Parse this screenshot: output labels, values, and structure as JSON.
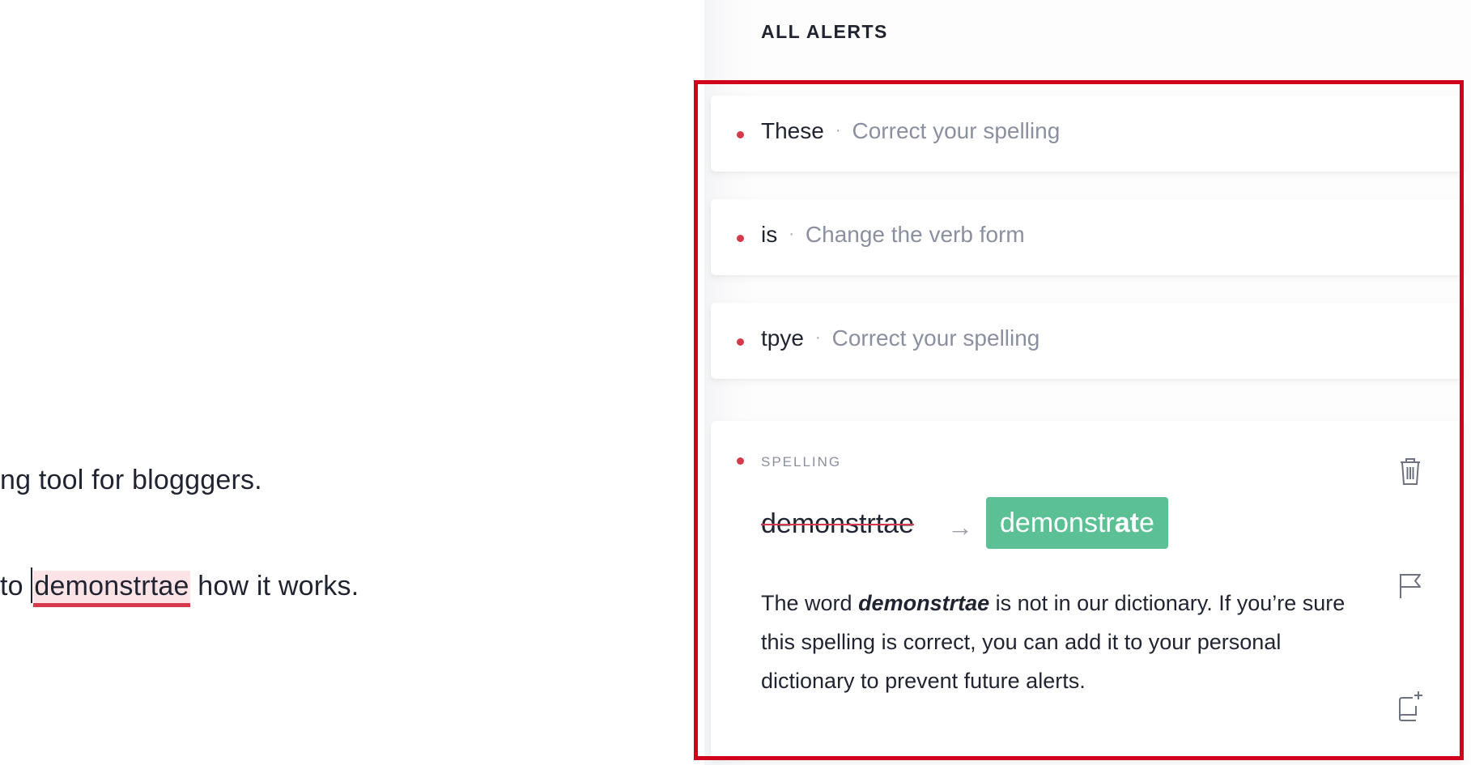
{
  "editor": {
    "line1": "ng tool for blogggers.",
    "line2_before": "to ",
    "line2_flagged": "demonstrtae",
    "line2_after": " how it works."
  },
  "sidebar": {
    "heading": "ALL ALERTS",
    "alerts": [
      {
        "word": "These",
        "separator": "·",
        "description": "Correct your spelling"
      },
      {
        "word": "is",
        "separator": "·",
        "description": "Change the verb form"
      },
      {
        "word": "tpye",
        "separator": "·",
        "description": "Correct your spelling"
      }
    ],
    "active_alert": {
      "category": "SPELLING",
      "wrong_word": "demonstrtae",
      "arrow": "→",
      "suggestion_plain": "demonstr",
      "suggestion_bold": "at",
      "suggestion_end": "e",
      "explanation_prefix": "The word ",
      "explanation_word": "demonstrtae",
      "explanation_suffix": " is not in our dictionary. If you’re sure this spelling is correct, you can add it to your personal dictionary to prevent future alerts."
    }
  },
  "icons": {
    "trash": "trash-icon",
    "flag": "flag-icon",
    "add_to_dictionary": "add-to-dictionary-icon"
  },
  "colors": {
    "alert_red": "#d4394c",
    "suggestion_green": "#5bc195",
    "highlight_box_red": "#d0021b",
    "flagged_bg": "#fbe3e6"
  }
}
